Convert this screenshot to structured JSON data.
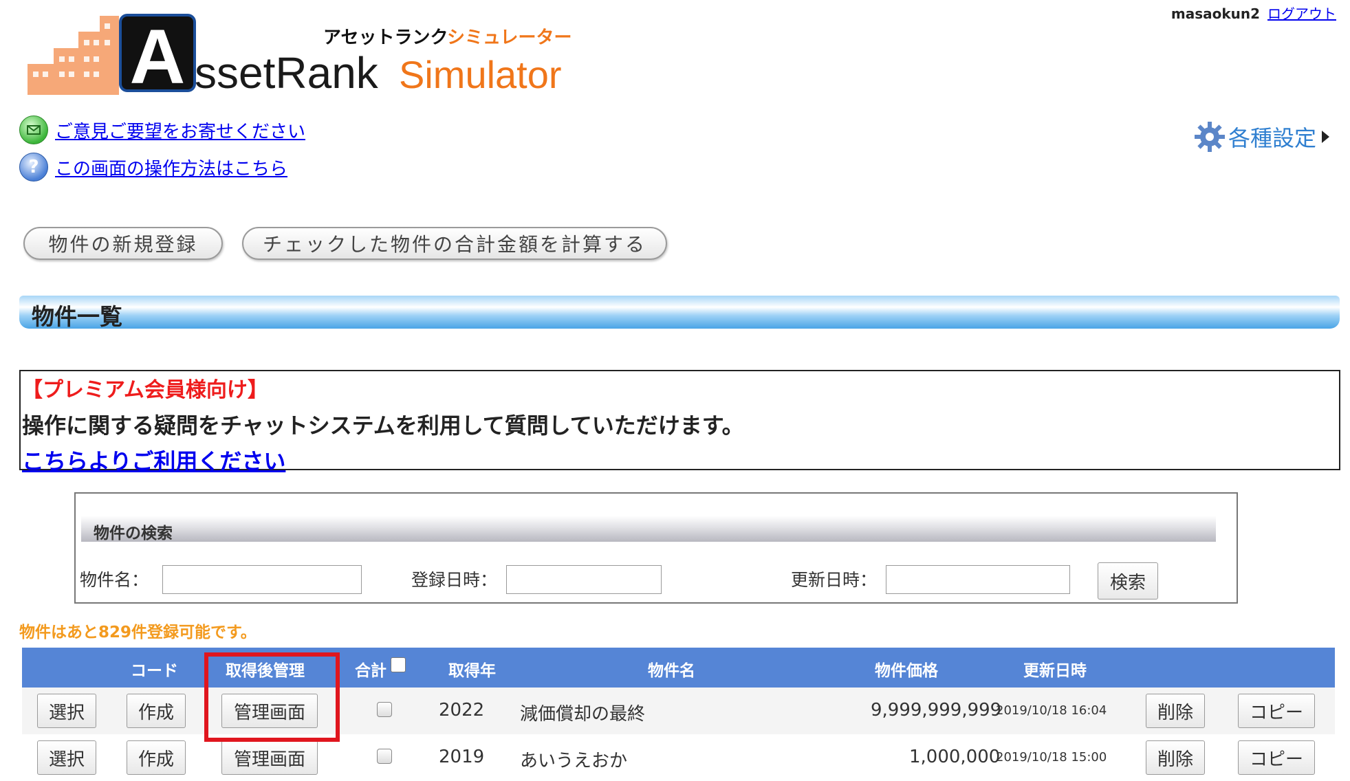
{
  "logo": {
    "kana": "アセットランク",
    "kana_sim": "シミュレーター",
    "asset": "ssetRank",
    "simulator": "Simulator"
  },
  "user": {
    "name": "masaokun2",
    "logout": "ログアウト"
  },
  "links": {
    "feedback": "ご意見ご要望をお寄せください",
    "help": "この画面の操作方法はこちら"
  },
  "settings": {
    "label": "各種設定"
  },
  "buttons": {
    "new_property": "物件の新規登録",
    "calc_total": "チェックした物件の合計金額を計算する"
  },
  "section": {
    "title": "物件一覧"
  },
  "notice": {
    "heading": "【プレミアム会員様向け】",
    "body": "操作に関する疑問をチャットシステムを利用して質問していただけます。",
    "link": "こちらよりご利用ください"
  },
  "search": {
    "heading": "物件の検索",
    "name_label": "物件名：",
    "reg_label": "登録日時：",
    "upd_label": "更新日時：",
    "button": "検索",
    "name_value": "",
    "reg_value": "",
    "upd_value": ""
  },
  "remaining": "物件はあと829件登録可能です。",
  "table": {
    "headers": {
      "code": "コード",
      "post_mgmt": "取得後管理",
      "total": "合計",
      "year": "取得年",
      "name": "物件名",
      "price": "物件価格",
      "updated": "更新日時"
    },
    "rows": [
      {
        "select": "選択",
        "create": "作成",
        "manage": "管理画面",
        "year": "2022",
        "name": "減価償却の最終",
        "price": "9,999,999,999",
        "updated": "2019/10/18 16:04",
        "delete": "削除",
        "copy": "コピー"
      },
      {
        "select": "選択",
        "create": "作成",
        "manage": "管理画面",
        "year": "2019",
        "name": "あいうえおか",
        "price": "1,000,000",
        "updated": "2019/10/18 15:00",
        "delete": "削除",
        "copy": "コピー"
      }
    ]
  },
  "colors": {
    "header_blue": "#5585d6",
    "highlight_red": "#e0161e",
    "notice_red": "#ee1c1c",
    "remaining_orange": "#f39a1e"
  }
}
